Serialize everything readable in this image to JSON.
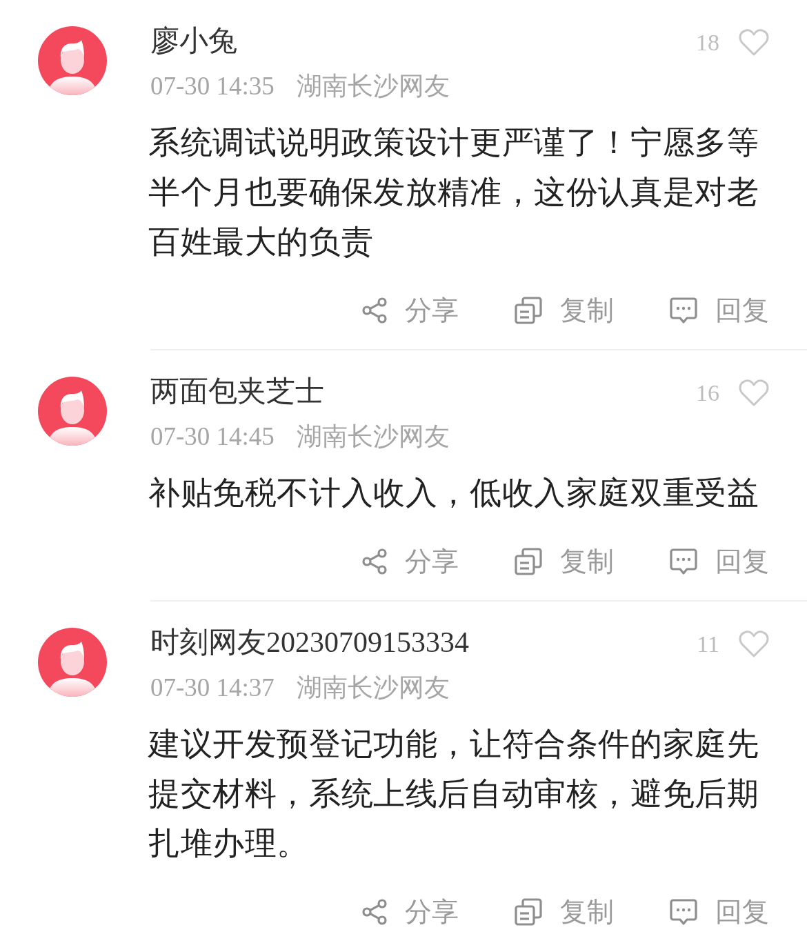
{
  "comments": [
    {
      "author": "廖小兔",
      "likes": "18",
      "liked": false,
      "time": "07-30 14:35",
      "location": "湖南长沙网友",
      "text": "系统调试说明政策设计更严谨了！宁愿多等半个月也要确保发放精准，这份认真是对老百姓最大的负责",
      "actions": [
        {
          "kind": "share",
          "label": "分享"
        },
        {
          "kind": "copy",
          "label": "复制"
        },
        {
          "kind": "reply",
          "label": "回复"
        }
      ]
    },
    {
      "author": "两面包夹芝士",
      "likes": "16",
      "liked": false,
      "time": "07-30 14:45",
      "location": "湖南长沙网友",
      "text": "补贴免税不计入收入，低收入家庭双重受益",
      "actions": [
        {
          "kind": "share",
          "label": "分享"
        },
        {
          "kind": "copy",
          "label": "复制"
        },
        {
          "kind": "reply",
          "label": "回复"
        }
      ]
    },
    {
      "author": "时刻网友20230709153334",
      "likes": "11",
      "liked": false,
      "time": "07-30 14:37",
      "location": "湖南长沙网友",
      "text": "建议开发预登记功能，让符合条件的家庭先提交材料，系统上线后自动审核，避免后期扎堆办理。",
      "actions": [
        {
          "kind": "share",
          "label": "分享"
        },
        {
          "kind": "copy",
          "label": "复制"
        },
        {
          "kind": "reply",
          "label": "回复"
        }
      ]
    }
  ]
}
